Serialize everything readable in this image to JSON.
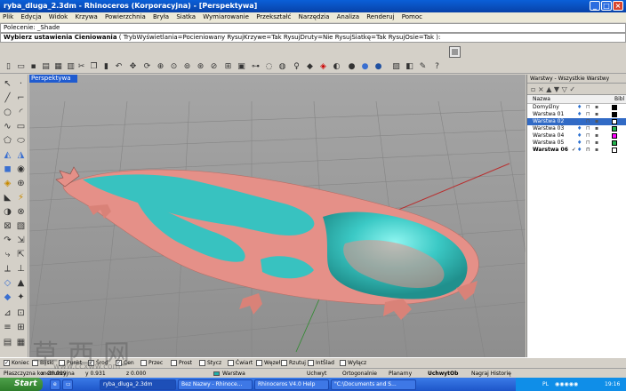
{
  "window": {
    "title": "ryba_dluga_2.3dm - Rhinoceros (Korporacyjna) - [Perspektywa]",
    "controls": [
      "_",
      "□",
      "×"
    ]
  },
  "menu": [
    "Plik",
    "Edycja",
    "Widok",
    "Krzywa",
    "Powierzchnia",
    "Bryła",
    "Siatka",
    "Wymiarowanie",
    "Przekształć",
    "Narzędzia",
    "Analiza",
    "Renderuj",
    "Pomoc"
  ],
  "command": {
    "history": "Polecenie: _Shade",
    "prompt_bold": "Wybierz ustawienia Cieniowania",
    "prompt_rest": " ( TrybWyświetlania=Pocieniowany  RysujKrzywe=Tak  RysujDruty=Nie  RysujSiatkę=Tak  RysujOsie=Tak ):"
  },
  "viewport": {
    "tab_label": "Perspektywa",
    "background": "#9b9b9b",
    "model_colors": {
      "pink": "#e59088",
      "teal": "#38c2c0"
    }
  },
  "layers_panel": {
    "header": "Warstwy - Wszystkie Warstwy",
    "col_name": "Nazwa",
    "col_material": "Bibl",
    "rows": [
      {
        "name": "Domyślny",
        "color": "#000000"
      },
      {
        "name": "Warstwa 01",
        "color": "#000000"
      },
      {
        "name": "Warstwa 02",
        "color": "#ffffff"
      },
      {
        "name": "Warstwa 03",
        "color": "#22b14c"
      },
      {
        "name": "Warstwa 04",
        "color": "#ff00ff"
      },
      {
        "name": "Warstwa 05",
        "color": "#22b14c"
      },
      {
        "name": "Warstwa 06",
        "color": "#ffffff"
      }
    ],
    "current_mark": "✓"
  },
  "osnap": [
    {
      "label": "Koniec",
      "checked": true
    },
    {
      "label": "Bliski",
      "checked": false
    },
    {
      "label": "Punkt",
      "checked": false
    },
    {
      "label": "Środ",
      "checked": true
    },
    {
      "label": "Cen",
      "checked": true
    },
    {
      "label": "Przec",
      "checked": false
    },
    {
      "label": "Prost",
      "checked": false
    },
    {
      "label": "Stycz",
      "checked": false
    },
    {
      "label": "Ćwiart",
      "checked": false
    },
    {
      "label": "Węzeł",
      "checked": false
    },
    {
      "label": "Rzutuj",
      "checked": false
    },
    {
      "label": "IntŚlad",
      "checked": false
    },
    {
      "label": "Wyłącz",
      "checked": false
    }
  ],
  "status": {
    "cplane": "Płaszczyzna konstrukcyjna",
    "x": "x -30.099",
    "y": "y 0.931",
    "z": "z 0.000",
    "layer": "Warstwa 06",
    "snap": "Uchwyt",
    "ortho": "Ortogonalnie",
    "planar": "Planarny",
    "osnap": "UchwytOb",
    "history": "Nagraj Historię"
  },
  "taskbar": {
    "start": "Start",
    "tasks": [
      "ryba_dluga_2.3dm",
      "Bez Nazwy - Rhinoce...",
      "Rhinoceros V4.0 Help",
      "\"C:\\Documents and S..."
    ],
    "tray_lang": "PL",
    "clock": "19:16"
  },
  "watermark": {
    "chars": "草西网",
    "url": "www.ccxww.com"
  }
}
